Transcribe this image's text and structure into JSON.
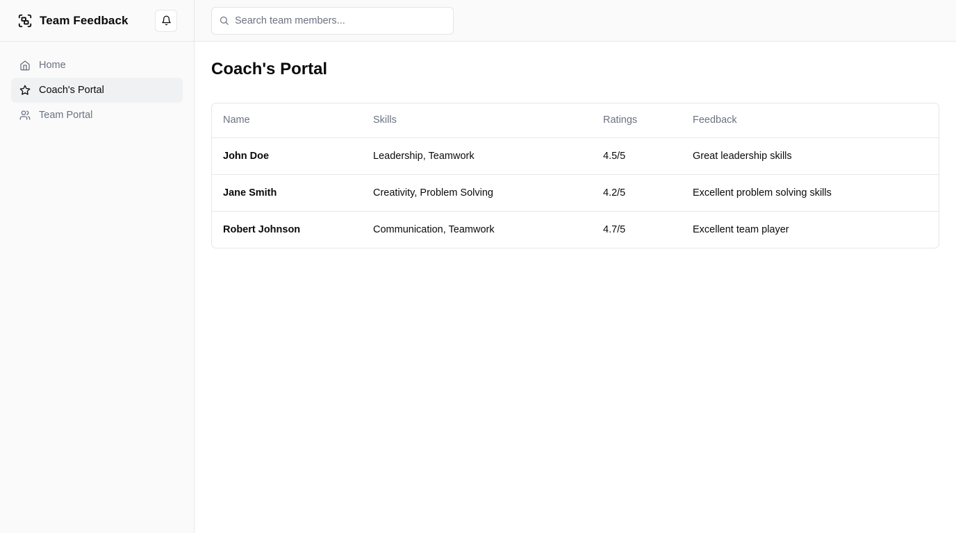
{
  "app": {
    "title": "Team Feedback"
  },
  "sidebar": {
    "items": [
      {
        "label": "Home",
        "icon": "home-icon",
        "active": false
      },
      {
        "label": "Coach's Portal",
        "icon": "star-icon",
        "active": true
      },
      {
        "label": "Team Portal",
        "icon": "users-icon",
        "active": false
      }
    ]
  },
  "search": {
    "placeholder": "Search team members...",
    "value": ""
  },
  "main": {
    "title": "Coach's Portal",
    "table": {
      "headers": [
        "Name",
        "Skills",
        "Ratings",
        "Feedback"
      ],
      "rows": [
        {
          "name": "John Doe",
          "skills": "Leadership, Teamwork",
          "rating": "4.5/5",
          "feedback": "Great leadership skills"
        },
        {
          "name": "Jane Smith",
          "skills": "Creativity, Problem Solving",
          "rating": "4.2/5",
          "feedback": "Excellent problem solving skills"
        },
        {
          "name": "Robert Johnson",
          "skills": "Communication, Teamwork",
          "rating": "4.7/5",
          "feedback": "Excellent team player"
        }
      ]
    }
  },
  "colors": {
    "accent": "#0a0a0a",
    "muted_text": "#6b7280",
    "border": "#e5e7eb",
    "sidebar_bg": "#fafafa",
    "active_item_bg": "#f0f1f3"
  }
}
